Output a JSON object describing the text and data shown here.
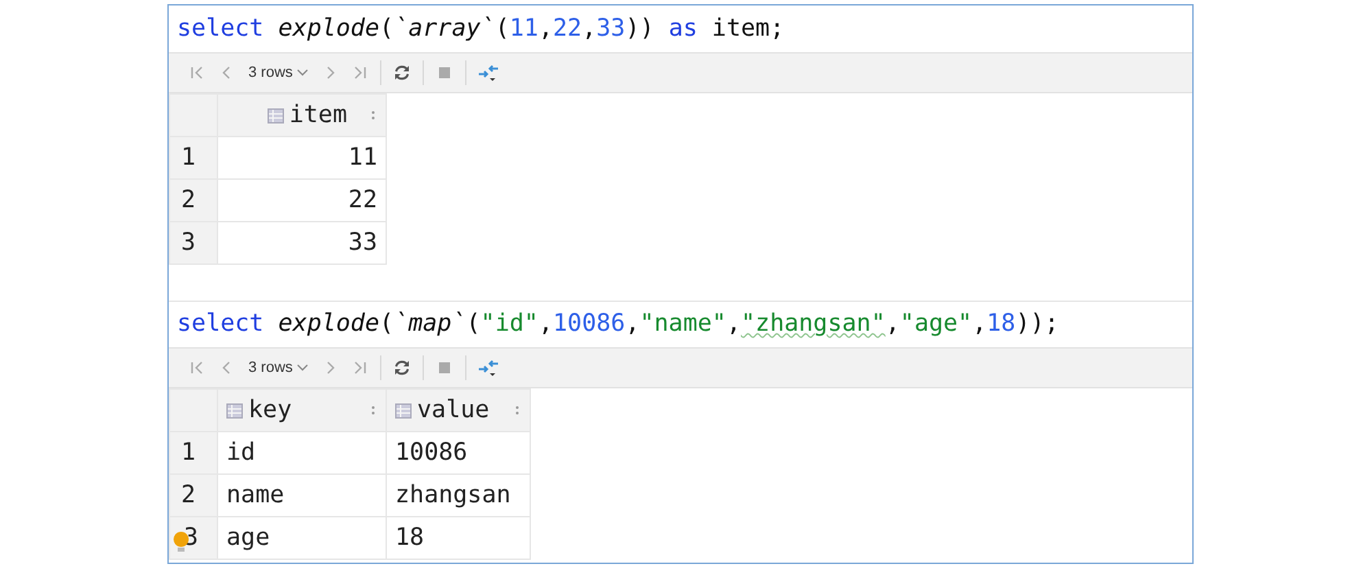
{
  "blocks": [
    {
      "query": [
        {
          "text": "select",
          "kind": "keyword"
        },
        {
          "text": " explode",
          "kind": "func"
        },
        {
          "text": "(",
          "kind": "plain"
        },
        {
          "text": "`array`",
          "kind": "func"
        },
        {
          "text": "(",
          "kind": "plain"
        },
        {
          "text": "11",
          "kind": "number"
        },
        {
          "text": ",",
          "kind": "plain"
        },
        {
          "text": "22",
          "kind": "number"
        },
        {
          "text": ",",
          "kind": "plain"
        },
        {
          "text": "33",
          "kind": "number"
        },
        {
          "text": "))",
          "kind": "plain"
        },
        {
          "text": " as",
          "kind": "keyword"
        },
        {
          "text": " item;",
          "kind": "plain"
        }
      ],
      "toolbar": {
        "rows_label": "3 rows"
      },
      "table": {
        "columns": [
          {
            "label": "item",
            "kind": "numeric"
          }
        ],
        "rows": [
          {
            "number": "1",
            "cells": [
              "11"
            ]
          },
          {
            "number": "2",
            "cells": [
              "22"
            ]
          },
          {
            "number": "3",
            "cells": [
              "33"
            ]
          }
        ]
      }
    },
    {
      "query": [
        {
          "text": "select",
          "kind": "keyword"
        },
        {
          "text": " explode",
          "kind": "func"
        },
        {
          "text": "(",
          "kind": "plain"
        },
        {
          "text": "`map`",
          "kind": "func"
        },
        {
          "text": "(",
          "kind": "plain"
        },
        {
          "text": "\"id\"",
          "kind": "string"
        },
        {
          "text": ",",
          "kind": "plain"
        },
        {
          "text": "10086",
          "kind": "number"
        },
        {
          "text": ",",
          "kind": "plain"
        },
        {
          "text": "\"name\"",
          "kind": "string"
        },
        {
          "text": ",",
          "kind": "plain"
        },
        {
          "text": "\"zhangsan\"",
          "kind": "typo"
        },
        {
          "text": ",",
          "kind": "plain"
        },
        {
          "text": "\"age\"",
          "kind": "string"
        },
        {
          "text": ",",
          "kind": "plain"
        },
        {
          "text": "18",
          "kind": "number"
        },
        {
          "text": "));",
          "kind": "plain"
        }
      ],
      "toolbar": {
        "rows_label": "3 rows"
      },
      "table": {
        "columns": [
          {
            "label": "key",
            "kind": "text"
          },
          {
            "label": "value",
            "kind": "text"
          }
        ],
        "rows": [
          {
            "number": "1",
            "cells": [
              "id",
              "10086"
            ]
          },
          {
            "number": "2",
            "cells": [
              "name",
              "zhangsan"
            ]
          },
          {
            "number": "3",
            "cells": [
              "age",
              "18"
            ],
            "bulb": true
          }
        ]
      }
    }
  ]
}
